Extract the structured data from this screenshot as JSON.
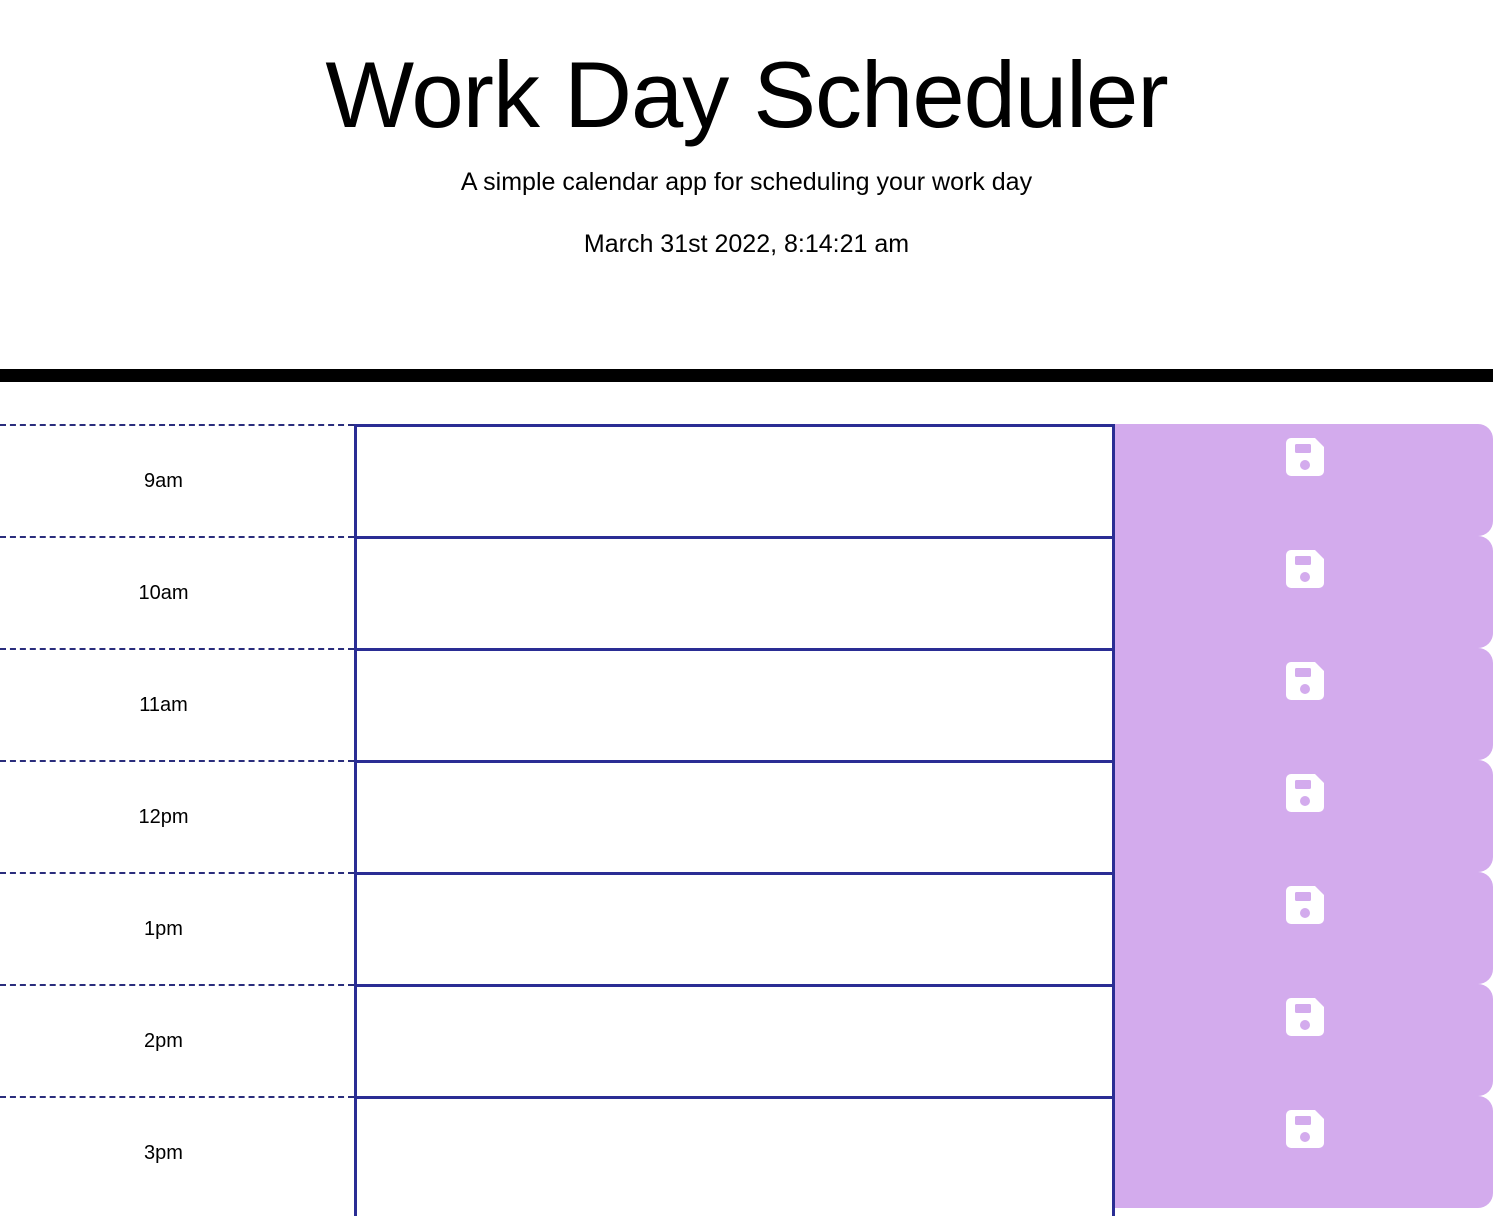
{
  "header": {
    "title": "Work Day Scheduler",
    "subtitle": "A simple calendar app for scheduling your work day",
    "current_datetime": "March 31st 2022, 8:14:21 am"
  },
  "colors": {
    "save_button": "#d3abed",
    "border": "#2a2d94",
    "header_rule": "#000000"
  },
  "time_blocks": [
    {
      "hour": "9am",
      "text": "",
      "icon": "save-icon"
    },
    {
      "hour": "10am",
      "text": "",
      "icon": "save-icon"
    },
    {
      "hour": "11am",
      "text": "",
      "icon": "save-icon"
    },
    {
      "hour": "12pm",
      "text": "",
      "icon": "save-icon"
    },
    {
      "hour": "1pm",
      "text": "",
      "icon": "save-icon"
    },
    {
      "hour": "2pm",
      "text": "",
      "icon": "save-icon"
    },
    {
      "hour": "3pm",
      "text": "",
      "icon": "save-icon"
    }
  ]
}
